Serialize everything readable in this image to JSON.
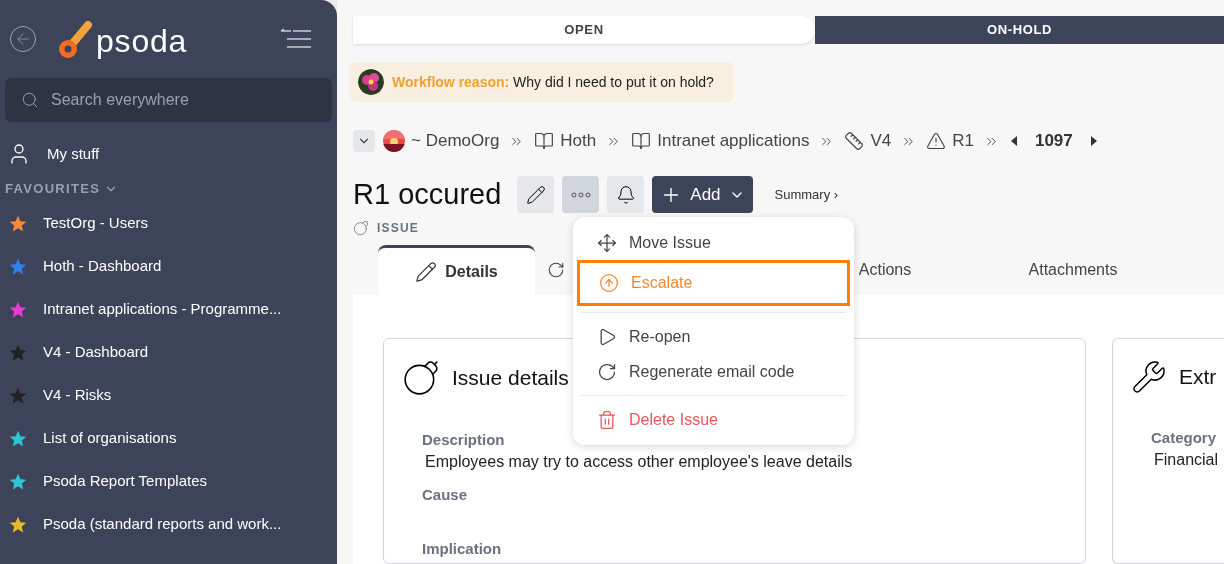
{
  "sidebar": {
    "logo_text": "psoda",
    "search": {
      "placeholder": "Search everywhere"
    },
    "my_stuff": "My stuff",
    "favourites_heading": "FAVOURITES",
    "favourites": [
      {
        "label": "TestOrg - Users",
        "color": "#f58a3b"
      },
      {
        "label": "Hoth - Dashboard",
        "color": "#2f80ed"
      },
      {
        "label": "Intranet applications - Programme...",
        "color": "#e83ad8"
      },
      {
        "label": "V4 - Dashboard",
        "color": "#222222"
      },
      {
        "label": "V4 - Risks",
        "color": "#222222"
      },
      {
        "label": "List of organisations",
        "color": "#2ec4d6"
      },
      {
        "label": "Psoda Report Templates",
        "color": "#2ec4d6"
      },
      {
        "label": "Psoda (standard reports and work...",
        "color": "#e8b923"
      }
    ]
  },
  "workflow": [
    {
      "label": "OPEN",
      "selected": false
    },
    {
      "label": "ON-HOLD",
      "selected": true
    }
  ],
  "workflow_reason": {
    "label": "Workflow reason:",
    "text": "Why did I need to put it on hold?"
  },
  "breadcrumb": [
    {
      "kind": "org",
      "label": "~ DemoOrg"
    },
    {
      "kind": "book",
      "label": "Hoth"
    },
    {
      "kind": "book",
      "label": "Intranet applications"
    },
    {
      "kind": "box",
      "label": "V4"
    },
    {
      "kind": "warning",
      "label": "R1"
    }
  ],
  "record_number": "1097",
  "title": "R1 occured",
  "type": "ISSUE",
  "add_button": "Add",
  "summary_link": "Summary ›",
  "tabs": [
    {
      "kind": "details",
      "label": "Details",
      "selected": true
    },
    {
      "kind": "refresh",
      "selected": false
    },
    {
      "kind": "text",
      "label": "Actions",
      "selected": false
    },
    {
      "kind": "text",
      "label": "Attachments",
      "selected": false
    }
  ],
  "menu": [
    [
      {
        "kind": "move",
        "label": "Move Issue",
        "highlighted": false
      },
      {
        "kind": "escalate",
        "label": "Escalate",
        "highlighted": true
      }
    ],
    [
      {
        "kind": "reopen",
        "label": "Re-open",
        "highlighted": false
      },
      {
        "kind": "regenerate",
        "label": "Regenerate email code",
        "highlighted": false
      }
    ],
    [
      {
        "kind": "delete",
        "label": "Delete Issue",
        "highlighted": false
      }
    ]
  ],
  "issue_card": {
    "title": "Issue details",
    "fields": [
      {
        "label": "Description",
        "value": "Employees may try to access other employee's leave details"
      },
      {
        "label": "Cause"
      },
      {
        "label": "Implication"
      }
    ]
  },
  "extra_card": {
    "title": "Extr",
    "fields": [
      {
        "label": "Category",
        "value": "Financial"
      }
    ]
  }
}
